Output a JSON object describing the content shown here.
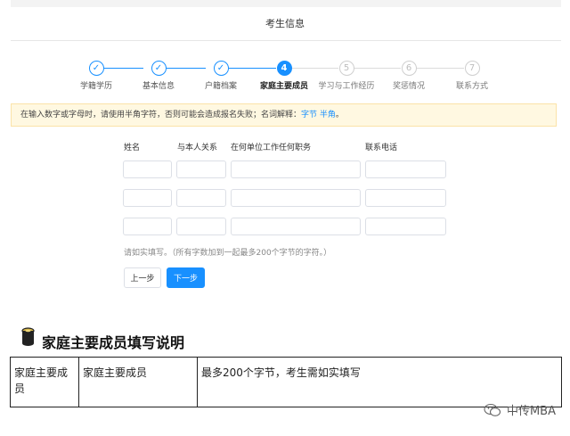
{
  "header": {
    "title": "考生信息"
  },
  "steps": [
    {
      "number": "1",
      "label": "学籍学历",
      "status": "done"
    },
    {
      "number": "2",
      "label": "基本信息",
      "status": "done"
    },
    {
      "number": "3",
      "label": "户籍档案",
      "status": "done"
    },
    {
      "number": "4",
      "label": "家庭主要成员",
      "status": "active"
    },
    {
      "number": "5",
      "label": "学习与工作经历",
      "status": "todo"
    },
    {
      "number": "6",
      "label": "奖惩情况",
      "status": "todo"
    },
    {
      "number": "7",
      "label": "联系方式",
      "status": "todo"
    }
  ],
  "check_glyph": "✓",
  "notice": {
    "text": "在输入数字或字母时，请使用半角字符，否则可能会造成报名失败；名词解释：",
    "link1": "字节",
    "link2": "半角",
    "suffix": "。"
  },
  "form": {
    "columns": {
      "name": "姓名",
      "relation": "与本人关系",
      "employer": "在何单位工作任何职务",
      "phone": "联系电话"
    },
    "rows": [
      {
        "name": "",
        "relation": "",
        "employer": "",
        "phone": ""
      },
      {
        "name": "",
        "relation": "",
        "employer": "",
        "phone": ""
      },
      {
        "name": "",
        "relation": "",
        "employer": "",
        "phone": ""
      }
    ],
    "hint": "请如实填写。（所有字数加到一起最多200个字节的字符。）",
    "prev_label": "上一步",
    "next_label": "下一步"
  },
  "section": {
    "icon": "paper-roll-icon",
    "title": "家庭主要成员填写说明",
    "table": {
      "col1": "家庭主要成员",
      "col2": "家庭主要成员",
      "col3": "最多200个字节，考生需如实填写"
    }
  },
  "watermark": {
    "icon": "wechat-icon",
    "text": "中传MBA"
  },
  "colors": {
    "accent": "#1890ff",
    "notice_bg": "#fff8e1",
    "muted": "#cfcfcf"
  }
}
